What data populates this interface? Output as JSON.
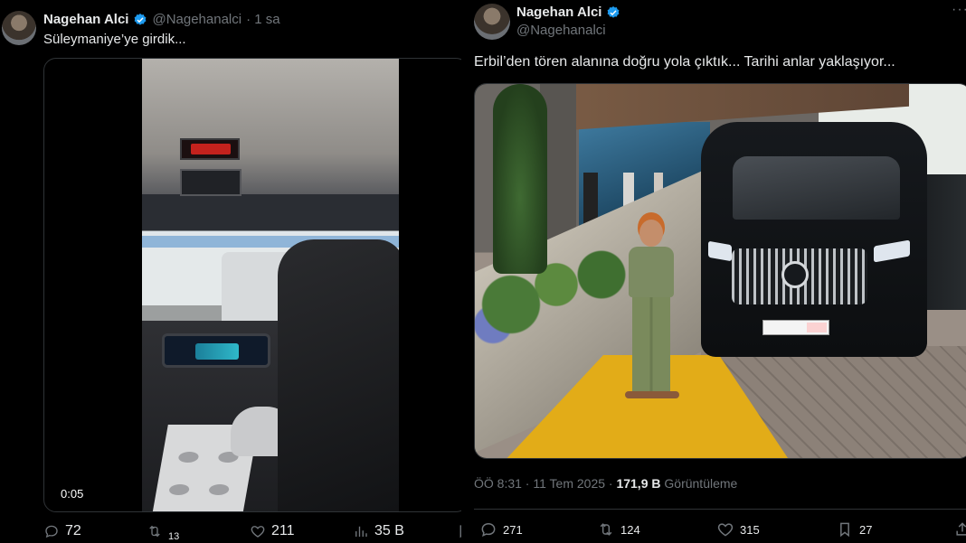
{
  "left_tweet": {
    "author_name": "Nagehan Alci",
    "handle": "@Nagehanalci",
    "time": "· 1 sa",
    "text": "Süleymaniye’ye girdik...",
    "video_duration": "0:05",
    "actions": {
      "replies": "72",
      "reposts": "13",
      "likes": "211",
      "views": "35 B"
    }
  },
  "right_tweet": {
    "author_name": "Nagehan Alci",
    "handle": "@Nagehanalci",
    "text": "Erbil’den tören alanına doğru yola çıktık... Tarihi anlar yaklaşıyor...",
    "timestamp": "ÖÖ 8:31 · 11 Tem 2025 ·",
    "views_count": "171,9 B",
    "views_label": "Görüntüleme",
    "actions": {
      "replies": "271",
      "reposts": "124",
      "likes": "315",
      "bookmarks": "27"
    }
  },
  "colors": {
    "background": "#000000",
    "text": "#e7e9ea",
    "muted": "#71767b",
    "verified": "#1d9bf0",
    "divider": "#2f3336"
  }
}
